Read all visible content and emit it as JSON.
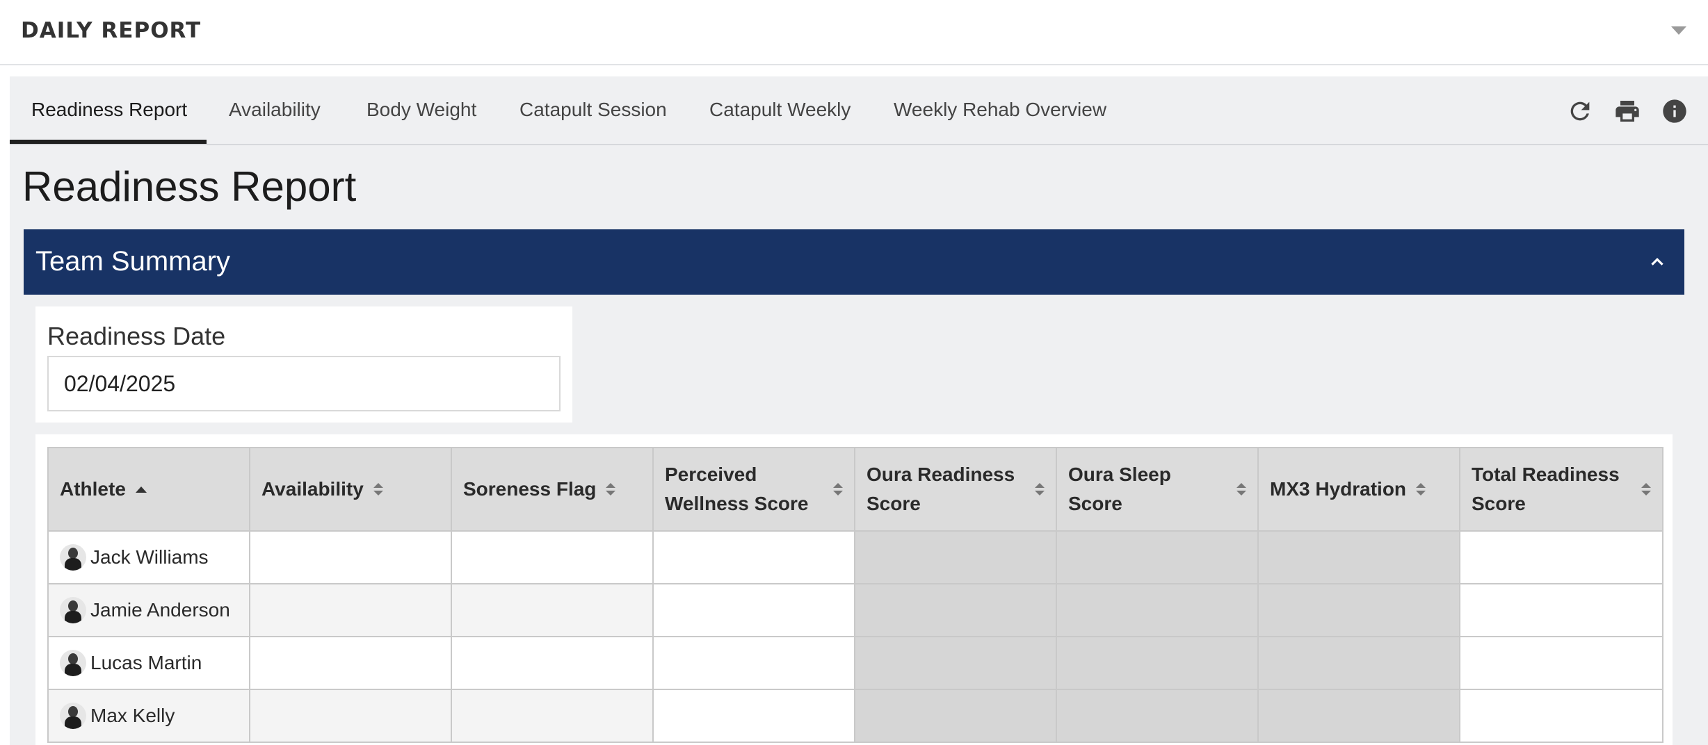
{
  "app": {
    "title": "DAILY REPORT"
  },
  "tabs": [
    {
      "label": "Readiness Report",
      "active": true
    },
    {
      "label": "Availability"
    },
    {
      "label": "Body Weight"
    },
    {
      "label": "Catapult Session"
    },
    {
      "label": "Catapult Weekly"
    },
    {
      "label": "Weekly Rehab Overview"
    }
  ],
  "toolbar": {
    "icons": [
      "refresh-icon",
      "print-icon",
      "info-icon"
    ]
  },
  "page": {
    "title": "Readiness Report"
  },
  "team_summary": {
    "label": "Team Summary",
    "expanded": true
  },
  "date_filter": {
    "label": "Readiness Date",
    "value": "02/04/2025"
  },
  "table": {
    "columns": [
      {
        "label": "Athlete",
        "sort": "ascending"
      },
      {
        "label": "Availability"
      },
      {
        "label": "Soreness Flag"
      },
      {
        "label": "Perceived Wellness Score"
      },
      {
        "label": "Oura Readiness Score"
      },
      {
        "label": "Oura Sleep Score"
      },
      {
        "label": "MX3 Hydration"
      },
      {
        "label": "Total Readiness Score"
      }
    ],
    "rows": [
      {
        "athlete": "Jack Williams"
      },
      {
        "athlete": "Jamie Anderson"
      },
      {
        "athlete": "Lucas Martin"
      },
      {
        "athlete": "Max Kelly"
      }
    ]
  },
  "colors": {
    "header_bar": "#183365",
    "page_bg": "#eff0f2",
    "table_header": "#dcdcdc",
    "no_data_cell": "#d6d6d6"
  }
}
